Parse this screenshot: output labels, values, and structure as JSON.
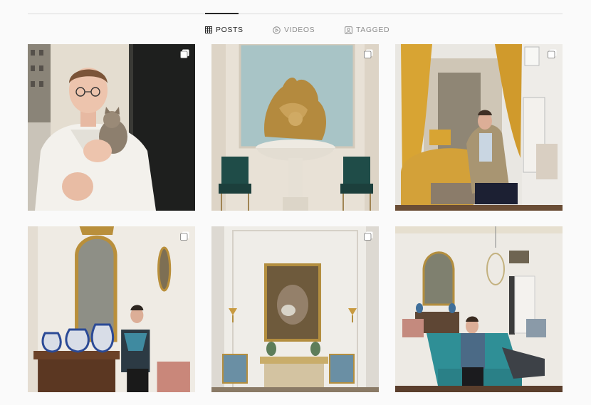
{
  "tabs": [
    {
      "label": "POSTS",
      "icon": "grid-icon",
      "active": true
    },
    {
      "label": "VIDEOS",
      "icon": "play-circle-icon",
      "active": false
    },
    {
      "label": "TAGGED",
      "icon": "tag-portrait-icon",
      "active": false
    }
  ],
  "colors": {
    "active_text": "#262626",
    "inactive_text": "#8e8e8e",
    "divider": "#dbdbdb",
    "background": "#fafafa"
  },
  "posts": [
    {
      "multi_image": true
    },
    {
      "multi_image": true
    },
    {
      "multi_image": true
    },
    {
      "multi_image": true
    },
    {
      "multi_image": true
    },
    {
      "multi_image": false
    }
  ]
}
